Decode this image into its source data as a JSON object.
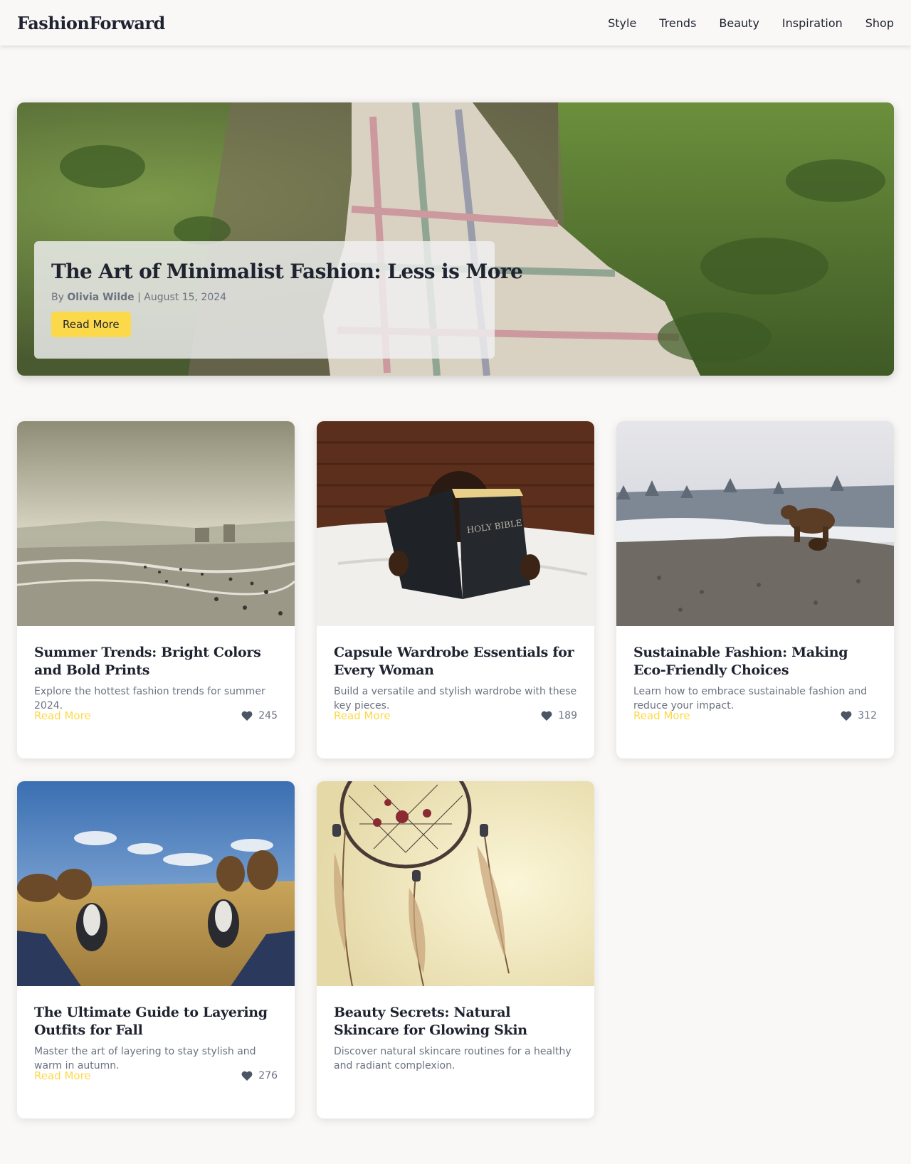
{
  "header": {
    "logo": "FashionForward",
    "nav": [
      "Style",
      "Trends",
      "Beauty",
      "Inspiration",
      "Shop"
    ]
  },
  "hero": {
    "title": "The Art of Minimalist Fashion: Less is More",
    "by_prefix": "By",
    "author": "Olivia Wilde",
    "separator": "|",
    "date": "August 15, 2024",
    "button": "Read More",
    "image": "child-in-plaid-blanket"
  },
  "articles": [
    {
      "title": "Summer Trends: Bright Colors and Bold Prints",
      "description": "Explore the hottest fashion trends for summer 2024.",
      "link": "Read More",
      "likes": "245",
      "image": "beach-scene"
    },
    {
      "title": "Capsule Wardrobe Essentials for Every Woman",
      "description": "Build a versatile and stylish wardrobe with these key pieces.",
      "link": "Read More",
      "likes": "189",
      "image": "child-reading-bible",
      "book_text": "HOLY BIBLE"
    },
    {
      "title": "Sustainable Fashion: Making Eco-Friendly Choices",
      "description": "Learn how to embrace sustainable fashion and reduce your impact.",
      "link": "Read More",
      "likes": "312",
      "image": "bear-on-rocks"
    },
    {
      "title": "The Ultimate Guide to Layering Outfits for Fall",
      "description": "Master the art of layering to stay stylish and warm in autumn.",
      "link": "Read More",
      "likes": "276",
      "image": "sneakers-in-field"
    },
    {
      "title": "Beauty Secrets: Natural Skincare for Glowing Skin",
      "description": "Discover natural skincare routines for a healthy and radiant complexion.",
      "image": "dreamcatcher"
    }
  ],
  "colors": {
    "accent": "#fcd94a",
    "text": "#1f2330",
    "muted": "#6b7280",
    "background": "#f9f8f6"
  }
}
